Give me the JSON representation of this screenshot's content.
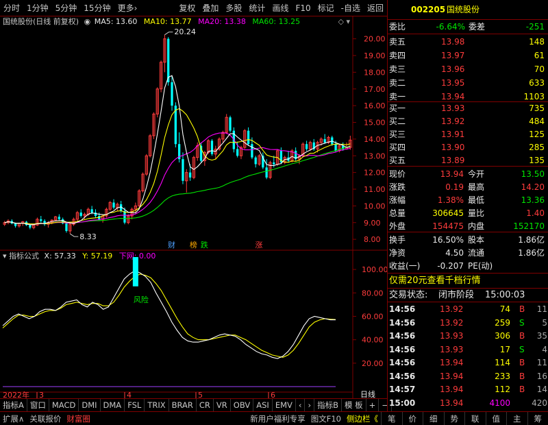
{
  "toolbar": {
    "left": [
      "分时",
      "1分钟",
      "5分钟",
      "15分钟",
      "更多›"
    ],
    "right": [
      "复权",
      "叠加",
      "多股",
      "统计",
      "画线",
      "F10",
      "标记",
      "-自选",
      "返回"
    ]
  },
  "chart_title": {
    "name": "国统股份(日线 前复权)",
    "ma5": "MA5: 13.60",
    "ma10": "MA10: 13.77",
    "ma20": "MA20: 13.38",
    "ma60": "MA60: 13.25",
    "icons": "◇ ▾"
  },
  "price_axis": [
    "20.00",
    "19.00",
    "18.00",
    "17.00",
    "16.00",
    "15.00",
    "14.00",
    "13.00",
    "12.00",
    "11.00",
    "10.00",
    "9.00",
    "8.00"
  ],
  "annotations": {
    "high": "20.24",
    "low": "8.33",
    "markers": [
      {
        "label": "财",
        "color": "#4ea0ff"
      },
      {
        "label": "榜",
        "color": "#ffaa00"
      },
      {
        "label": "跌",
        "color": "#00e600"
      },
      {
        "label": "涨",
        "color": "#ff3c3c"
      }
    ]
  },
  "indicator_title": {
    "name": "指标公式",
    "x": "X: 57.33",
    "y": "Y: 57.19",
    "down": "下网: 0.00"
  },
  "indicator_axis": [
    "100.00",
    "80.00",
    "60.00",
    "40.00",
    "20.00"
  ],
  "indicator_label": "风险",
  "date_axis": {
    "year": "2022年",
    "months": [
      "3",
      "4",
      "5",
      "6"
    ],
    "period": "日线"
  },
  "indicator_tabs": [
    "指标A",
    "窗口",
    "MACD",
    "DMI",
    "DMA",
    "FSL",
    "TRIX",
    "BRAR",
    "CR",
    "VR",
    "OBV",
    "ASI",
    "EMV",
    "‹",
    "›",
    "指标B",
    "模 板",
    "+",
    "−"
  ],
  "status_left": [
    "扩展∧",
    "关联报价",
    "财富圈"
  ],
  "status_right": [
    "新用户福利专享",
    "图文F10",
    "侧边栏《"
  ],
  "status_tabs": [
    "笔",
    "价",
    "细",
    "势",
    "联",
    "值",
    "主",
    "筹"
  ],
  "quote": {
    "code": "002205",
    "name": "国统股份",
    "webi": {
      "label": "委比",
      "value": "-6.64%",
      "label2": "委差",
      "value2": "-251"
    },
    "sell": [
      {
        "label": "卖五",
        "price": "13.98",
        "vol": "148"
      },
      {
        "label": "卖四",
        "price": "13.97",
        "vol": "61"
      },
      {
        "label": "卖三",
        "price": "13.96",
        "vol": "70"
      },
      {
        "label": "卖二",
        "price": "13.95",
        "vol": "633"
      },
      {
        "label": "卖一",
        "price": "13.94",
        "vol": "1103"
      }
    ],
    "buy": [
      {
        "label": "买一",
        "price": "13.93",
        "vol": "735"
      },
      {
        "label": "买二",
        "price": "13.92",
        "vol": "484"
      },
      {
        "label": "买三",
        "price": "13.91",
        "vol": "125"
      },
      {
        "label": "买四",
        "price": "13.90",
        "vol": "285"
      },
      {
        "label": "买五",
        "price": "13.89",
        "vol": "135"
      }
    ],
    "stats": [
      {
        "l1": "现价",
        "v1": "13.94",
        "c1": "red",
        "l2": "今开",
        "v2": "13.50",
        "c2": "grn"
      },
      {
        "l1": "涨跌",
        "v1": "0.19",
        "c1": "red",
        "l2": "最高",
        "v2": "14.20",
        "c2": "red"
      },
      {
        "l1": "涨幅",
        "v1": "1.38%",
        "c1": "red",
        "l2": "最低",
        "v2": "13.36",
        "c2": "grn"
      },
      {
        "l1": "总量",
        "v1": "306645",
        "c1": "yel",
        "l2": "量比",
        "v2": "1.40",
        "c2": "red"
      },
      {
        "l1": "外盘",
        "v1": "154475",
        "c1": "red",
        "l2": "内盘",
        "v2": "152170",
        "c2": "grn"
      }
    ],
    "fin": [
      {
        "l1": "换手",
        "v1": "16.50%",
        "l2": "股本",
        "v2": "1.86亿"
      },
      {
        "l1": "净资",
        "v1": "4.50",
        "l2": "流通",
        "v2": "1.86亿"
      },
      {
        "l1": "收益(一)",
        "v1": "-0.207",
        "l2": "PE(动)",
        "v2": ""
      }
    ],
    "promo": "仅需20元查看千档行情",
    "trade_status": {
      "label": "交易状态:",
      "value": "闭市阶段",
      "time": "15:00:03"
    },
    "ticks": [
      {
        "t": "14:56",
        "p": "13.92",
        "v": "74",
        "bs": "B",
        "n": "11"
      },
      {
        "t": "14:56",
        "p": "13.92",
        "v": "259",
        "bs": "S",
        "n": "5"
      },
      {
        "t": "14:56",
        "p": "13.93",
        "v": "306",
        "bs": "B",
        "n": "35"
      },
      {
        "t": "14:56",
        "p": "13.93",
        "v": "17",
        "bs": "S",
        "n": "4"
      },
      {
        "t": "14:56",
        "p": "13.94",
        "v": "114",
        "bs": "B",
        "n": "11"
      },
      {
        "t": "14:56",
        "p": "13.94",
        "v": "233",
        "bs": "B",
        "n": "16"
      },
      {
        "t": "14:57",
        "p": "13.94",
        "v": "112",
        "bs": "B",
        "n": "14"
      },
      {
        "t": "15:00",
        "p": "13.94",
        "v": "4100",
        "bs": "",
        "n": "420"
      }
    ]
  },
  "colors": {
    "up": "#ff3c3c",
    "down": "#00ffff",
    "ma5": "#ffffff",
    "ma10": "#ffff00",
    "ma20": "#ff00ff",
    "ma60": "#00e600",
    "frame": "#800000"
  },
  "chart_data": {
    "type": "candlestick",
    "ylim": [
      7.8,
      20.6
    ],
    "candles": [
      [
        8.9,
        9.1,
        8.8,
        9.0
      ],
      [
        9.0,
        9.2,
        8.9,
        9.1
      ],
      [
        9.1,
        9.2,
        8.9,
        8.95
      ],
      [
        8.95,
        9.0,
        8.7,
        8.8
      ],
      [
        8.8,
        9.0,
        8.7,
        8.95
      ],
      [
        8.95,
        9.1,
        8.8,
        9.05
      ],
      [
        9.05,
        9.1,
        8.8,
        8.85
      ],
      [
        8.85,
        8.9,
        8.6,
        8.7
      ],
      [
        8.7,
        8.9,
        8.6,
        8.85
      ],
      [
        8.85,
        9.3,
        8.8,
        9.2
      ],
      [
        9.2,
        9.4,
        9.0,
        9.1
      ],
      [
        9.1,
        9.2,
        8.8,
        8.9
      ],
      [
        8.9,
        9.1,
        8.7,
        9.0
      ],
      [
        9.0,
        9.2,
        8.9,
        9.15
      ],
      [
        9.15,
        9.4,
        9.1,
        9.35
      ],
      [
        9.35,
        9.5,
        9.1,
        9.2
      ],
      [
        9.2,
        9.3,
        8.9,
        8.95
      ],
      [
        8.95,
        9.0,
        8.4,
        8.5
      ],
      [
        8.5,
        9.0,
        8.33,
        8.9
      ],
      [
        8.9,
        9.3,
        8.8,
        9.2
      ],
      [
        9.2,
        9.7,
        9.1,
        9.6
      ],
      [
        9.6,
        9.8,
        9.3,
        9.4
      ],
      [
        9.4,
        9.6,
        9.2,
        9.5
      ],
      [
        9.5,
        9.9,
        9.4,
        9.8
      ],
      [
        9.8,
        10.0,
        9.5,
        9.6
      ],
      [
        9.6,
        9.8,
        9.3,
        9.4
      ],
      [
        9.4,
        9.6,
        9.1,
        9.2
      ],
      [
        9.2,
        9.5,
        9.0,
        9.4
      ],
      [
        9.4,
        9.9,
        9.3,
        9.8
      ],
      [
        9.8,
        10.3,
        9.7,
        10.2
      ],
      [
        10.2,
        10.4,
        9.8,
        9.9
      ],
      [
        9.9,
        10.2,
        9.7,
        10.1
      ],
      [
        10.1,
        10.3,
        9.6,
        9.7
      ],
      [
        9.7,
        9.9,
        8.9,
        9.0
      ],
      [
        9.0,
        9.5,
        8.9,
        9.4
      ],
      [
        9.4,
        9.9,
        9.2,
        9.8
      ],
      [
        9.8,
        10.2,
        9.6,
        10.0
      ],
      [
        10.0,
        11.0,
        9.9,
        10.9
      ],
      [
        10.9,
        12.0,
        10.8,
        11.9
      ],
      [
        11.9,
        13.1,
        11.8,
        13.0
      ],
      [
        13.0,
        14.3,
        12.9,
        14.2
      ],
      [
        14.2,
        15.6,
        14.0,
        15.5
      ],
      [
        15.5,
        17.1,
        15.3,
        17.0
      ],
      [
        17.0,
        18.7,
        16.8,
        18.6
      ],
      [
        18.6,
        20.24,
        18.0,
        20.0
      ],
      [
        20.0,
        20.1,
        17.2,
        17.4
      ],
      [
        17.4,
        17.8,
        15.7,
        16.0
      ],
      [
        16.0,
        16.2,
        13.5,
        13.7
      ],
      [
        13.7,
        14.4,
        12.6,
        12.8
      ],
      [
        12.8,
        13.2,
        11.3,
        11.5
      ],
      [
        11.5,
        12.2,
        10.8,
        12.0
      ],
      [
        12.0,
        12.5,
        11.5,
        11.7
      ],
      [
        11.7,
        13.0,
        11.6,
        12.9
      ],
      [
        12.9,
        13.8,
        12.7,
        13.6
      ],
      [
        13.6,
        13.8,
        12.6,
        12.7
      ],
      [
        12.7,
        13.3,
        12.4,
        13.2
      ],
      [
        13.2,
        14.0,
        13.1,
        13.9
      ],
      [
        13.9,
        14.0,
        13.0,
        13.1
      ],
      [
        13.1,
        13.6,
        12.8,
        13.4
      ],
      [
        13.4,
        14.1,
        13.3,
        14.0
      ],
      [
        14.0,
        14.5,
        13.8,
        14.4
      ],
      [
        14.4,
        15.5,
        14.3,
        15.3
      ],
      [
        15.3,
        15.4,
        14.4,
        14.5
      ],
      [
        14.5,
        14.7,
        13.2,
        13.4
      ],
      [
        13.4,
        13.8,
        12.9,
        13.0
      ],
      [
        13.0,
        13.6,
        12.8,
        13.5
      ],
      [
        13.5,
        14.6,
        13.4,
        14.5
      ],
      [
        14.5,
        14.7,
        13.6,
        13.7
      ],
      [
        13.7,
        14.1,
        12.8,
        12.9
      ],
      [
        12.9,
        13.0,
        12.3,
        12.5
      ],
      [
        12.5,
        13.1,
        12.4,
        13.0
      ],
      [
        13.0,
        13.2,
        12.2,
        12.3
      ],
      [
        12.3,
        12.8,
        11.6,
        11.7
      ],
      [
        11.7,
        12.7,
        11.6,
        12.6
      ],
      [
        12.6,
        13.0,
        12.3,
        12.5
      ],
      [
        12.5,
        13.4,
        12.4,
        13.3
      ],
      [
        13.3,
        13.5,
        12.5,
        12.6
      ],
      [
        12.6,
        13.0,
        12.5,
        12.9
      ],
      [
        12.9,
        13.3,
        12.6,
        12.7
      ],
      [
        12.7,
        13.4,
        12.6,
        13.3
      ],
      [
        13.3,
        13.5,
        12.7,
        12.8
      ],
      [
        12.8,
        13.1,
        12.5,
        13.0
      ],
      [
        13.0,
        13.8,
        12.9,
        13.7
      ],
      [
        13.7,
        13.9,
        13.3,
        13.4
      ],
      [
        13.4,
        13.9,
        13.3,
        13.8
      ],
      [
        13.8,
        14.0,
        13.3,
        13.4
      ],
      [
        13.4,
        13.9,
        13.2,
        13.8
      ],
      [
        13.8,
        14.1,
        13.6,
        14.0
      ],
      [
        14.0,
        14.3,
        13.7,
        13.8
      ],
      [
        13.8,
        14.2,
        13.7,
        14.1
      ],
      [
        14.1,
        14.2,
        13.6,
        13.7
      ],
      [
        13.7,
        13.9,
        13.2,
        13.3
      ],
      [
        13.3,
        13.7,
        13.2,
        13.6
      ],
      [
        13.6,
        13.8,
        13.3,
        13.4
      ],
      [
        13.4,
        13.8,
        13.36,
        13.5
      ],
      [
        13.5,
        14.2,
        13.36,
        13.94
      ]
    ],
    "indicator": {
      "ylim": [
        0,
        110
      ],
      "k": [
        52,
        56,
        60,
        62,
        60,
        58,
        60,
        64,
        66,
        66,
        65,
        68,
        72,
        73,
        74,
        70,
        68,
        72,
        70,
        66,
        68,
        76,
        84,
        92,
        96,
        99,
        97,
        94,
        89,
        80,
        72,
        64,
        55,
        48,
        42,
        39,
        38,
        38,
        39,
        40,
        42,
        44,
        45,
        44,
        43,
        40,
        36,
        33,
        30,
        28,
        27,
        25,
        24,
        26,
        30,
        36,
        44,
        52,
        58,
        60,
        59,
        58,
        57,
        57
      ],
      "d": [
        50,
        54,
        58,
        61,
        61,
        60,
        60,
        62,
        64,
        65,
        65,
        67,
        70,
        71,
        72,
        71,
        70,
        71,
        71,
        69,
        69,
        72,
        78,
        85,
        90,
        94,
        96,
        95,
        93,
        88,
        82,
        74,
        66,
        58,
        51,
        45,
        42,
        40,
        40,
        40,
        41,
        42,
        43,
        44,
        44,
        42,
        40,
        37,
        34,
        31,
        29,
        27,
        26,
        25,
        27,
        31,
        37,
        44,
        51,
        55,
        57,
        58,
        57.5,
        57.2
      ]
    }
  }
}
